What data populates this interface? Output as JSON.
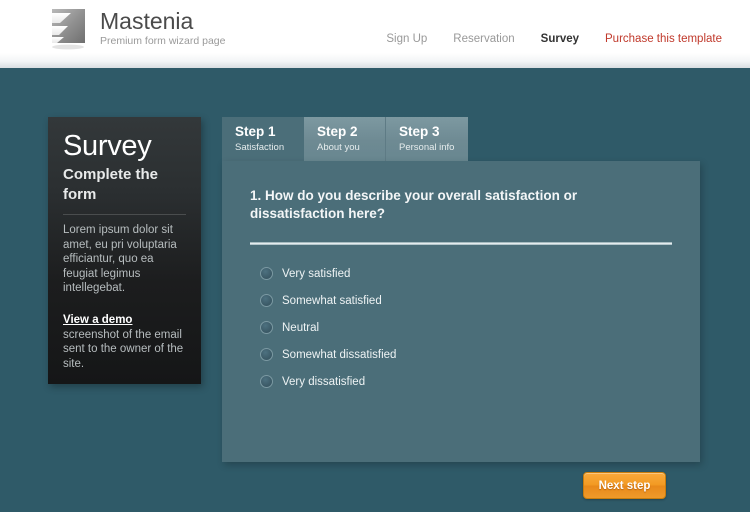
{
  "brand": {
    "name": "Mastenia",
    "tagline": "Premium form wizard page",
    "logo_icon": "flag-logo-icon"
  },
  "nav": {
    "items": [
      {
        "label": "Sign Up",
        "state": "default"
      },
      {
        "label": "Reservation",
        "state": "default"
      },
      {
        "label": "Survey",
        "state": "active"
      },
      {
        "label": "Purchase this template",
        "state": "cta"
      }
    ]
  },
  "sidebar": {
    "title": "Survey",
    "subtitle": "Complete the form",
    "body": "Lorem ipsum dolor sit amet, eu pri voluptaria efficiantur, quo ea feugiat legimus intellegebat.",
    "demo_link": "View a demo",
    "demo_text": "screenshot of the email sent to the owner of the site."
  },
  "tabs": [
    {
      "title": "Step 1",
      "subtitle": "Satisfaction",
      "active": true
    },
    {
      "title": "Step 2",
      "subtitle": "About you",
      "active": false
    },
    {
      "title": "Step 3",
      "subtitle": "Personal info",
      "active": false
    }
  ],
  "form": {
    "question": "1. How do you describe your overall satisfaction or dissatisfaction here?",
    "options": [
      {
        "label": "Very satisfied",
        "selected": false
      },
      {
        "label": "Somewhat satisfied",
        "selected": false
      },
      {
        "label": "Neutral",
        "selected": false
      },
      {
        "label": "Somewhat dissatisfied",
        "selected": false
      },
      {
        "label": "Very dissatisfied",
        "selected": false
      }
    ],
    "next_label": "Next step"
  },
  "colors": {
    "page_background": "#2f5a68",
    "panel": "#4b6e79",
    "tab_inactive": "#6e8a93",
    "sidebar_dark": "#1c1d1e",
    "accent_orange": "#f29a22",
    "cta_red": "#c0392b",
    "header_white": "#ffffff"
  }
}
